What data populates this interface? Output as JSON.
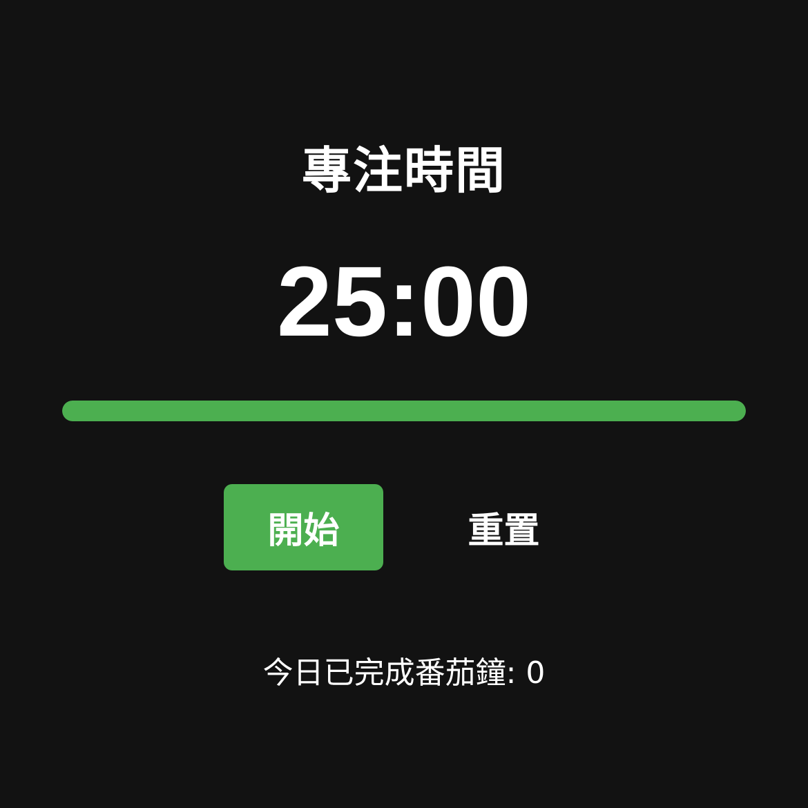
{
  "mode": {
    "title": "專注時間"
  },
  "timer": {
    "display": "25:00"
  },
  "progress": {
    "percent": 100,
    "color": "#4caf50"
  },
  "controls": {
    "start_label": "開始",
    "reset_label": "重置"
  },
  "stats": {
    "completed_label": "今日已完成番茄鐘: ",
    "completed_count": "0"
  },
  "colors": {
    "background": "#121212",
    "accent": "#4caf50",
    "text": "#ffffff"
  }
}
